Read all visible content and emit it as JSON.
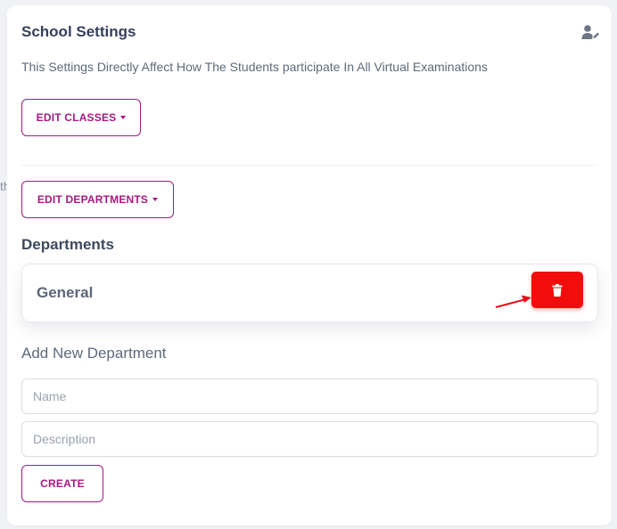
{
  "background_fragment": "th",
  "header": {
    "title": "School Settings",
    "subtitle": "This Settings Directly Affect How The Students participate In All Virtual Examinations",
    "icon": "user-edit-icon"
  },
  "buttons": {
    "edit_classes": "EDIT CLASSES",
    "edit_departments": "EDIT DEPARTMENTS",
    "create": "CREATE"
  },
  "departments": {
    "heading": "Departments",
    "items": [
      {
        "name": "General",
        "delete_icon": "trash-icon"
      }
    ]
  },
  "add_department": {
    "heading": "Add New Department",
    "name_placeholder": "Name",
    "description_placeholder": "Description"
  },
  "colors": {
    "accent": "#a6187f",
    "danger": "#f20c0c",
    "heading": "#34405a",
    "muted": "#5e6a7b"
  }
}
